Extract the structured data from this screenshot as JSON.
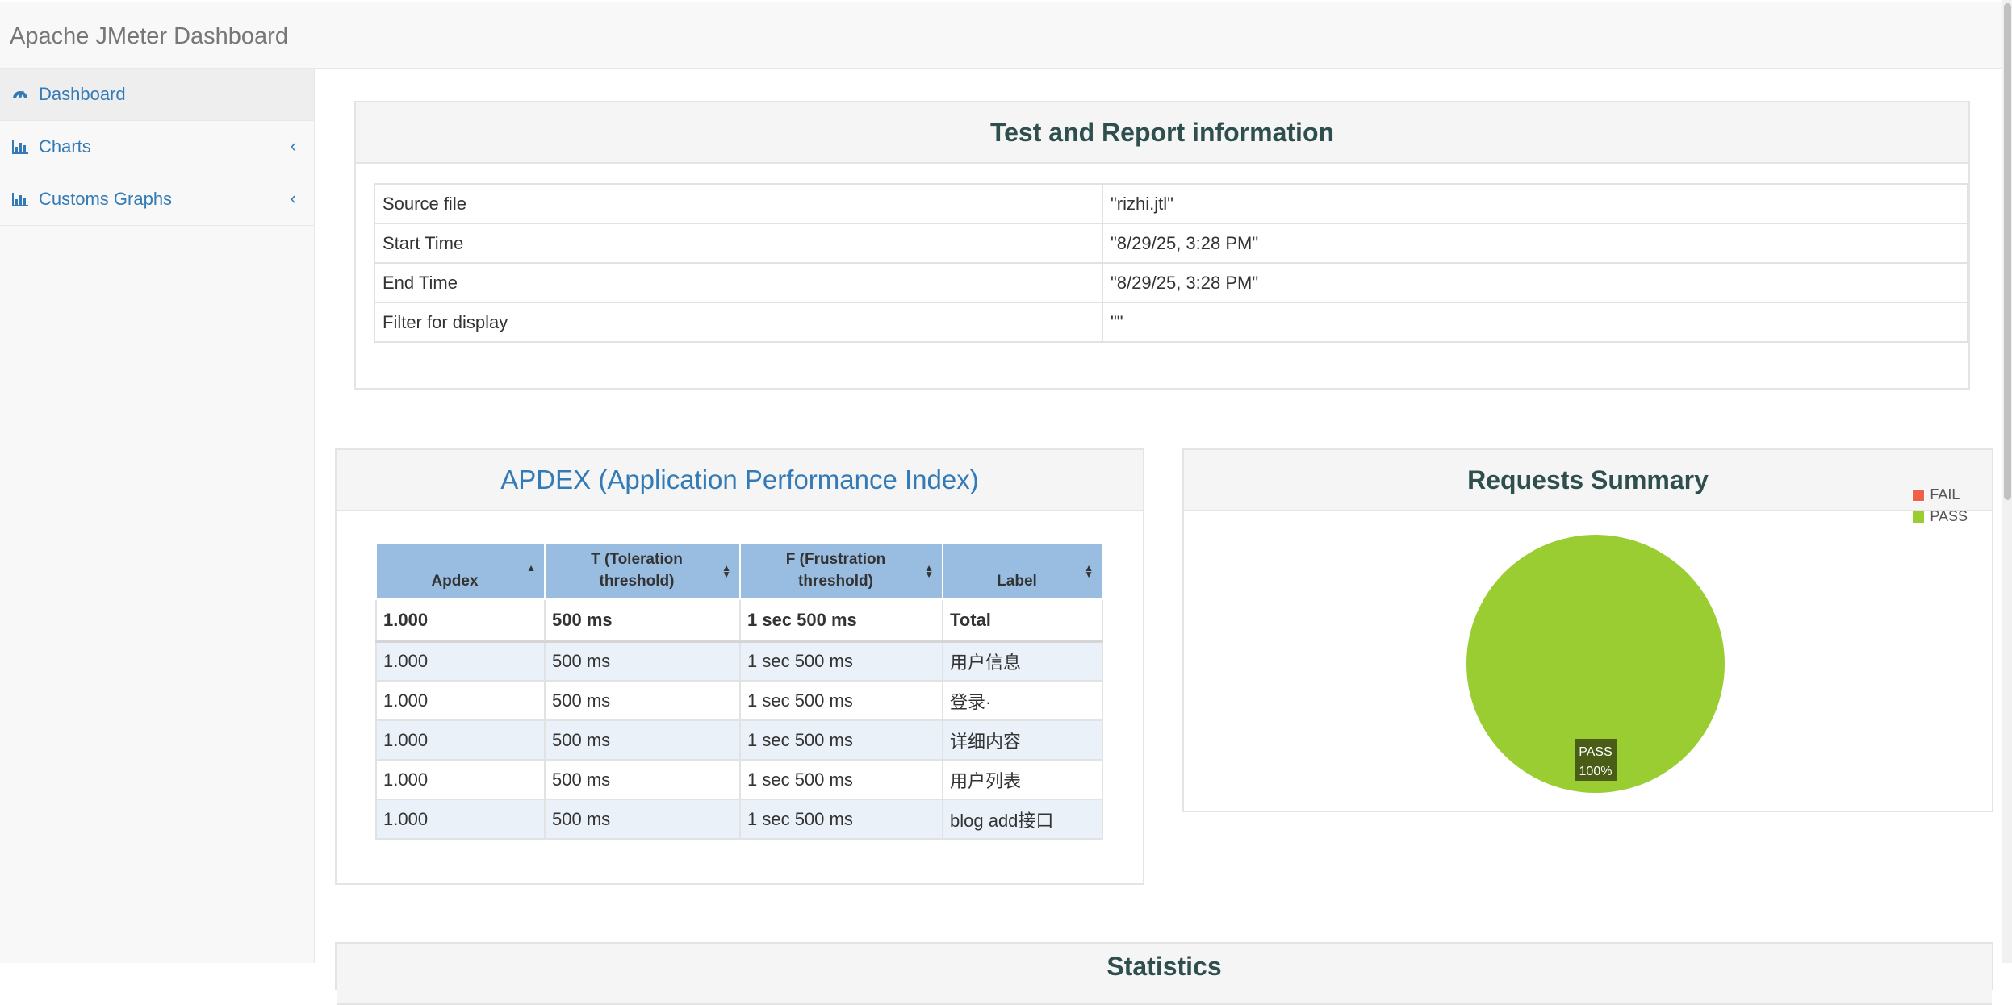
{
  "app": {
    "title": "Apache JMeter Dashboard"
  },
  "sidebar": {
    "items": [
      {
        "label": "Dashboard",
        "icon": "dashboard-icon"
      },
      {
        "label": "Charts",
        "icon": "bar-chart-icon"
      },
      {
        "label": "Customs Graphs",
        "icon": "bar-chart-icon"
      }
    ]
  },
  "test_info": {
    "title": "Test and Report information",
    "rows": [
      {
        "key": "Source file",
        "value": "\"rizhi.jtl\""
      },
      {
        "key": "Start Time",
        "value": "\"8/29/25, 3:28 PM\""
      },
      {
        "key": "End Time",
        "value": "\"8/29/25, 3:28 PM\""
      },
      {
        "key": "Filter for display",
        "value": "\"\""
      }
    ]
  },
  "apdex": {
    "title": "APDEX (Application Performance Index)",
    "headers": [
      "Apdex",
      "T (Toleration threshold)",
      "F (Frustration threshold)",
      "Label"
    ],
    "total": {
      "apdex": "1.000",
      "t": "500 ms",
      "f": "1 sec 500 ms",
      "label": "Total"
    },
    "rows": [
      {
        "apdex": "1.000",
        "t": "500 ms",
        "f": "1 sec 500 ms",
        "label": "用户信息"
      },
      {
        "apdex": "1.000",
        "t": "500 ms",
        "f": "1 sec 500 ms",
        "label": "登录·"
      },
      {
        "apdex": "1.000",
        "t": "500 ms",
        "f": "1 sec 500 ms",
        "label": "详细内容"
      },
      {
        "apdex": "1.000",
        "t": "500 ms",
        "f": "1 sec 500 ms",
        "label": "用户列表"
      },
      {
        "apdex": "1.000",
        "t": "500 ms",
        "f": "1 sec 500 ms",
        "label": "blog add接口"
      }
    ]
  },
  "requests_summary": {
    "title": "Requests Summary",
    "legend": [
      {
        "label": "FAIL",
        "color": "#f25f48"
      },
      {
        "label": "PASS",
        "color": "#9acd32"
      }
    ],
    "slice_label": "PASS",
    "slice_percent": "100%"
  },
  "statistics": {
    "title": "Statistics"
  },
  "chart_data": {
    "type": "pie",
    "categories": [
      "FAIL",
      "PASS"
    ],
    "values": [
      0,
      100
    ],
    "colors": [
      "#f25f48",
      "#9acd32"
    ],
    "title": "Requests Summary",
    "legend_position": "top-right"
  }
}
